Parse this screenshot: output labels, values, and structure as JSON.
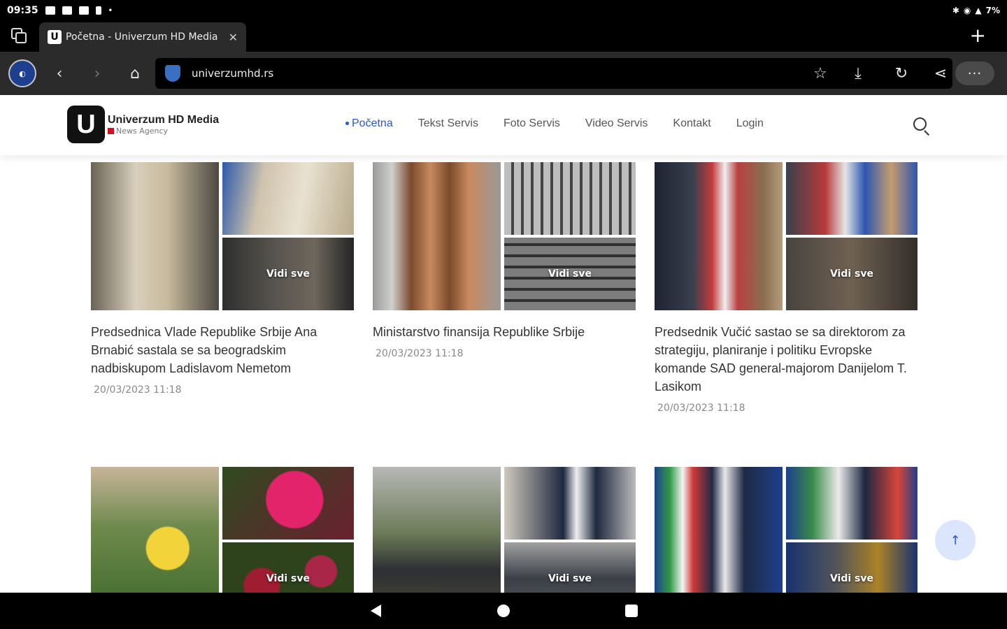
{
  "status_bar": {
    "time": "09:35",
    "battery": "7%"
  },
  "browser": {
    "tab_title": "Početna - Univerzum HD Media",
    "tab_favicon": "U",
    "url": "univerzumhd.rs",
    "more_label": "···"
  },
  "site": {
    "logo_mark": "U",
    "logo_name": "Univerzum HD Media",
    "logo_sub": "News Agency",
    "accent_color": "#2a55d6",
    "nav": [
      {
        "label": "Početna",
        "active": true
      },
      {
        "label": "Tekst Servis"
      },
      {
        "label": "Foto Servis"
      },
      {
        "label": "Video Servis"
      },
      {
        "label": "Kontakt"
      },
      {
        "label": "Login"
      }
    ]
  },
  "cards": [
    {
      "title": "Predsednica Vlade Republike Srbije Ana Brnabić sastala se sa beogradskim nadbiskupom Ladislavom Nemetom",
      "date": "20/03/2023 11:18",
      "more": "Vidi sve"
    },
    {
      "title": "Ministarstvo finansija Republike Srbije",
      "date": "20/03/2023 11:18",
      "more": "Vidi sve"
    },
    {
      "title": "Predsednik Vučić sastao se sa direktorom za strategiju, planiranje i politiku Evropske komande SAD general-majorom Danijelom T. Lasikom",
      "date": "20/03/2023 11:18",
      "more": "Vidi sve"
    },
    {
      "title": "",
      "date": "",
      "more": "Vidi sve"
    },
    {
      "title": "",
      "date": "",
      "more": "Vidi sve"
    },
    {
      "title": "",
      "date": "",
      "more": "Vidi sve"
    }
  ],
  "scroll_top_icon": "↑"
}
